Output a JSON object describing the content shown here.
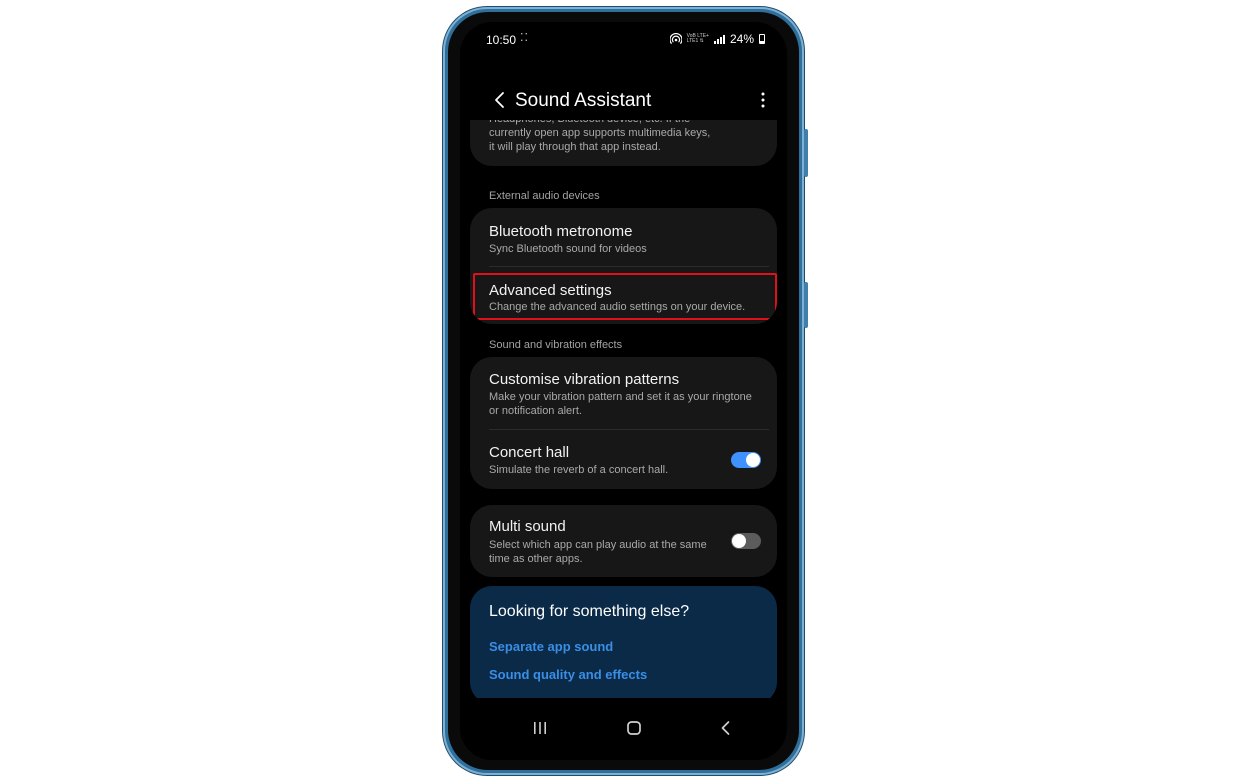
{
  "status_bar": {
    "time": "10:50",
    "notification_dots": "⁚⁚",
    "network_top": "VoB LTE+",
    "network_bottom": "LTE1 ⇅",
    "battery": "24%"
  },
  "app_bar": {
    "title": "Sound Assistant"
  },
  "top_card": {
    "partial_text": "Headphones, Bluetooth device, etc. If the\ncurrently open app supports multimedia keys,\nit will play through that app instead."
  },
  "sections": {
    "external_audio": "External audio devices",
    "sound_vibration": "Sound and vibration effects"
  },
  "external_audio_items": [
    {
      "title": "Bluetooth metronome",
      "subtitle": "Sync Bluetooth sound for videos"
    },
    {
      "title": "Advanced settings",
      "subtitle": "Change the advanced audio settings on your device."
    }
  ],
  "effects_items": [
    {
      "title": "Customise vibration patterns",
      "subtitle": "Make your vibration pattern and set it as your ringtone\nor notification alert."
    },
    {
      "title": "Concert hall",
      "subtitle": "Simulate the reverb of a concert hall.",
      "toggle": "on"
    }
  ],
  "multi_sound": {
    "title": "Multi sound",
    "subtitle": "Select which app can play audio at the same\ntime as other apps.",
    "toggle": "off"
  },
  "help": {
    "title": "Looking for something else?",
    "links": [
      "Separate app sound",
      "Sound quality and effects"
    ]
  },
  "nav": {
    "icons": [
      "recent-apps-icon",
      "home-icon",
      "back-icon"
    ]
  },
  "colors": {
    "accent": "#3e91ff",
    "link": "#3a8ee6",
    "highlight_box": "#e0111b",
    "card_bg": "#171717",
    "help_bg": "#0a2a48",
    "phone_frame": "#2f6f9b"
  }
}
